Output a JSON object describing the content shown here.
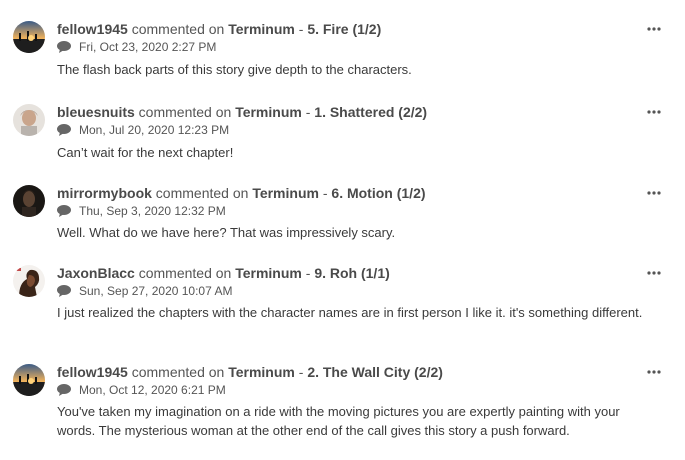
{
  "comments": [
    {
      "user": "fellow1945",
      "action": " commented on ",
      "story": "Terminum",
      "separator": " - ",
      "chapter": "5. Fire (1/2)",
      "timestamp": "Fri, Oct 23, 2020 2:27 PM",
      "text": "The flash back parts of this story give depth to the characters.",
      "avatar": "sunset-avatar"
    },
    {
      "user": "bleuesnuits",
      "action": " commented on ",
      "story": "Terminum",
      "separator": " - ",
      "chapter": "1. Shattered (2/2)",
      "timestamp": "Mon, Jul 20, 2020 12:23 PM",
      "text": "Can’t wait for the next chapter!",
      "avatar": "portrait-avatar"
    },
    {
      "user": "mirrormybook",
      "action": " commented on ",
      "story": "Terminum",
      "separator": " - ",
      "chapter": "6. Motion (1/2)",
      "timestamp": "Thu, Sep 3, 2020 12:32 PM",
      "text": "Well. What do we have here? That was impressively scary.",
      "avatar": "dark-portrait-avatar"
    },
    {
      "user": "JaxonBlacc",
      "action": " commented on ",
      "story": "Terminum",
      "separator": " - ",
      "chapter": "9. Roh (1/1)",
      "timestamp": "Sun, Sep 27, 2020 10:07 AM",
      "text": "I just realized the chapters with the character names are in first person I like it. it's something different.",
      "avatar": "profile-avatar"
    },
    {
      "user": "fellow1945",
      "action": " commented on ",
      "story": "Terminum",
      "separator": " - ",
      "chapter": "2. The Wall City (2/2)",
      "timestamp": "Mon, Oct 12, 2020 6:21 PM",
      "text": "You've taken my imagination on a ride with the moving pictures you are expertly painting with your words. The mysterious woman at the other end of the call gives this story a push forward.",
      "avatar": "sunset-avatar"
    }
  ],
  "icons": {
    "comment": "comment-bubble-icon",
    "more": "more-options-icon"
  },
  "colors": {
    "text": "#3a3a3a",
    "username": "#4a4a4a",
    "icon": "#666666"
  }
}
